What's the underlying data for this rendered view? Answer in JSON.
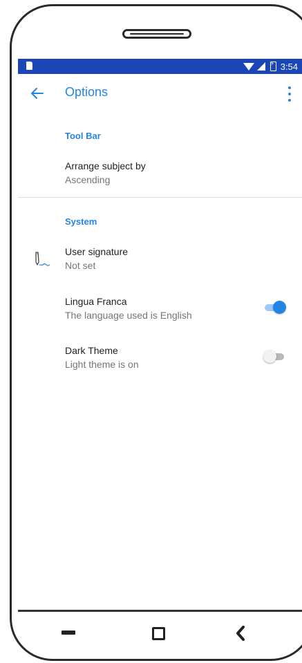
{
  "status_bar": {
    "time": "3:54",
    "icons": [
      "sd-card-icon",
      "wifi-icon",
      "signal-icon",
      "battery-charging-icon"
    ],
    "background": "#1b46b8"
  },
  "toolbar": {
    "title": "Options",
    "back_icon": "arrow-left-icon",
    "menu_icon": "overflow-menu-icon",
    "accent": "#2385e3"
  },
  "sections": [
    {
      "header": "Tool Bar",
      "items": [
        {
          "title": "Arrange subject by",
          "summary": "Ascending"
        }
      ]
    },
    {
      "header": "System",
      "items": [
        {
          "title": "User signature",
          "summary": "Not set",
          "icon": "pen-signature-icon"
        },
        {
          "title": "Lingua Franca",
          "summary": "The language used is English",
          "switch": true
        },
        {
          "title": "Dark Theme",
          "summary": "Light theme is on",
          "switch": false
        }
      ]
    }
  ],
  "nav_bar": {
    "icons": [
      "recents-icon",
      "home-icon",
      "back-icon"
    ]
  }
}
